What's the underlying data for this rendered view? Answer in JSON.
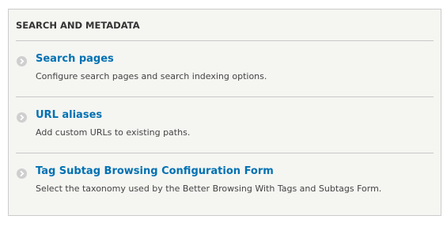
{
  "panel": {
    "title": "SEARCH AND METADATA",
    "items": [
      {
        "label": "Search pages",
        "description": "Configure search pages and search indexing options."
      },
      {
        "label": "URL aliases",
        "description": "Add custom URLs to existing paths."
      },
      {
        "label": "Tag Subtag Browsing Configuration Form",
        "description": "Select the taxonomy used by the Better Browsing With Tags and Subtags Form."
      }
    ]
  },
  "icons": {
    "bullet": "chevron-right-circle-icon"
  },
  "colors": {
    "link": "#0071b3",
    "bullet": "#cfcfcf",
    "panel_background": "#f5f5f2"
  }
}
